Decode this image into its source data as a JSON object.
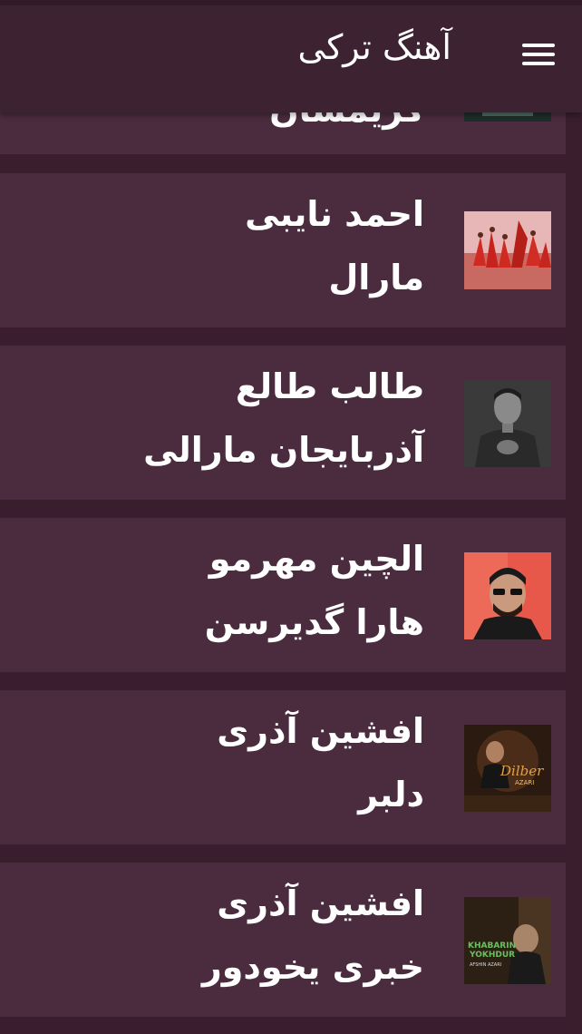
{
  "appbar": {
    "title": "آهنگ ترکی",
    "menu_icon": "hamburger-menu-icon"
  },
  "colors": {
    "background": "#3a1e2e",
    "card": "#4a2c3e",
    "appbar": "#3d2232",
    "text": "#ffffff"
  },
  "partial_item": {
    "title": "گریمسان"
  },
  "songs": [
    {
      "artist": "احمد نایبی",
      "title": "مارال"
    },
    {
      "artist": "طالب طالع",
      "title": "آذربایجان مارالی"
    },
    {
      "artist": "الچین مهرمو",
      "title": "هارا گدیرسن"
    },
    {
      "artist": "افشین آذری",
      "title": "دلبر",
      "cover_text": [
        "Dilber",
        "AZARI"
      ]
    },
    {
      "artist": "افشین آذری",
      "title": "خبری یخودور",
      "cover_text": [
        "KHABARIN",
        "YOKHDUR",
        "AFSHIN AZARI"
      ]
    }
  ]
}
